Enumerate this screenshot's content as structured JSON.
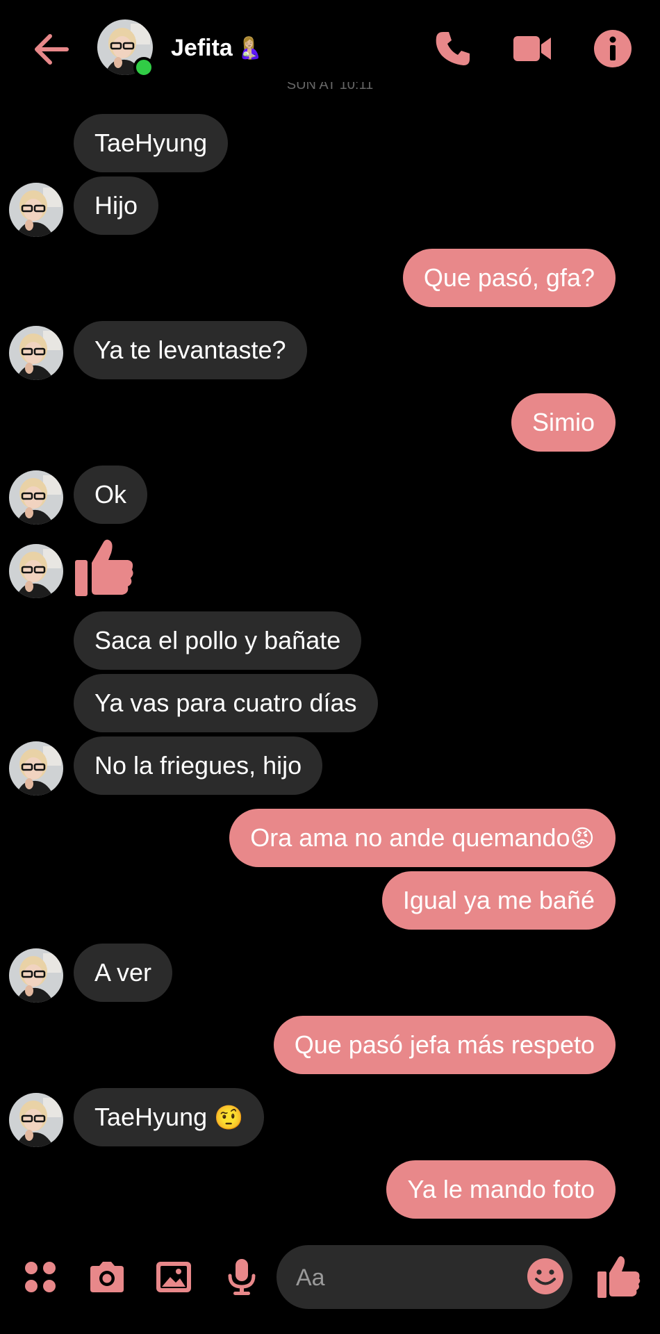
{
  "header": {
    "contact_name": "Jefita",
    "contact_emoji": "🤱🏼",
    "back_icon": "arrow-left-icon",
    "call_icon": "phone-icon",
    "video_icon": "video-camera-icon",
    "info_icon": "info-icon",
    "status": "online"
  },
  "time_separator": "SUN AT 10:11",
  "messages": [
    {
      "side": "in",
      "text": "TaeHyung"
    },
    {
      "side": "in",
      "text": "Hijo"
    },
    {
      "side": "out",
      "text": "Que pasó, gfa?"
    },
    {
      "side": "in",
      "text": "Ya te levantaste?"
    },
    {
      "side": "out",
      "text": "Simio"
    },
    {
      "side": "in",
      "text": "Ok"
    },
    {
      "side": "in",
      "icon": "thumbs-up-icon"
    },
    {
      "side": "in",
      "text": "Saca el pollo y bañate"
    },
    {
      "side": "in",
      "text": "Ya vas para cuatro días"
    },
    {
      "side": "in",
      "text": "No la friegues, hijo"
    },
    {
      "side": "out",
      "text": "Ora ama no ande quemando",
      "emoji": "😡"
    },
    {
      "side": "out",
      "text": "Igual ya me bañé"
    },
    {
      "side": "in",
      "text": "A ver"
    },
    {
      "side": "out",
      "text": "Que pasó jefa más respeto"
    },
    {
      "side": "in",
      "text": "TaeHyung ",
      "emoji": "🤨"
    },
    {
      "side": "out",
      "text": "Ya le mando foto"
    }
  ],
  "composer": {
    "placeholder": "Aa",
    "apps_icon": "four-dots-icon",
    "camera_icon": "camera-icon",
    "gallery_icon": "image-icon",
    "mic_icon": "microphone-icon",
    "emoji_icon": "smiley-icon",
    "like_icon": "thumbs-up-icon"
  },
  "colors": {
    "accent": "#e8888a",
    "incoming_bubble": "#2b2b2b",
    "background": "#000000",
    "online": "#31cc46"
  }
}
